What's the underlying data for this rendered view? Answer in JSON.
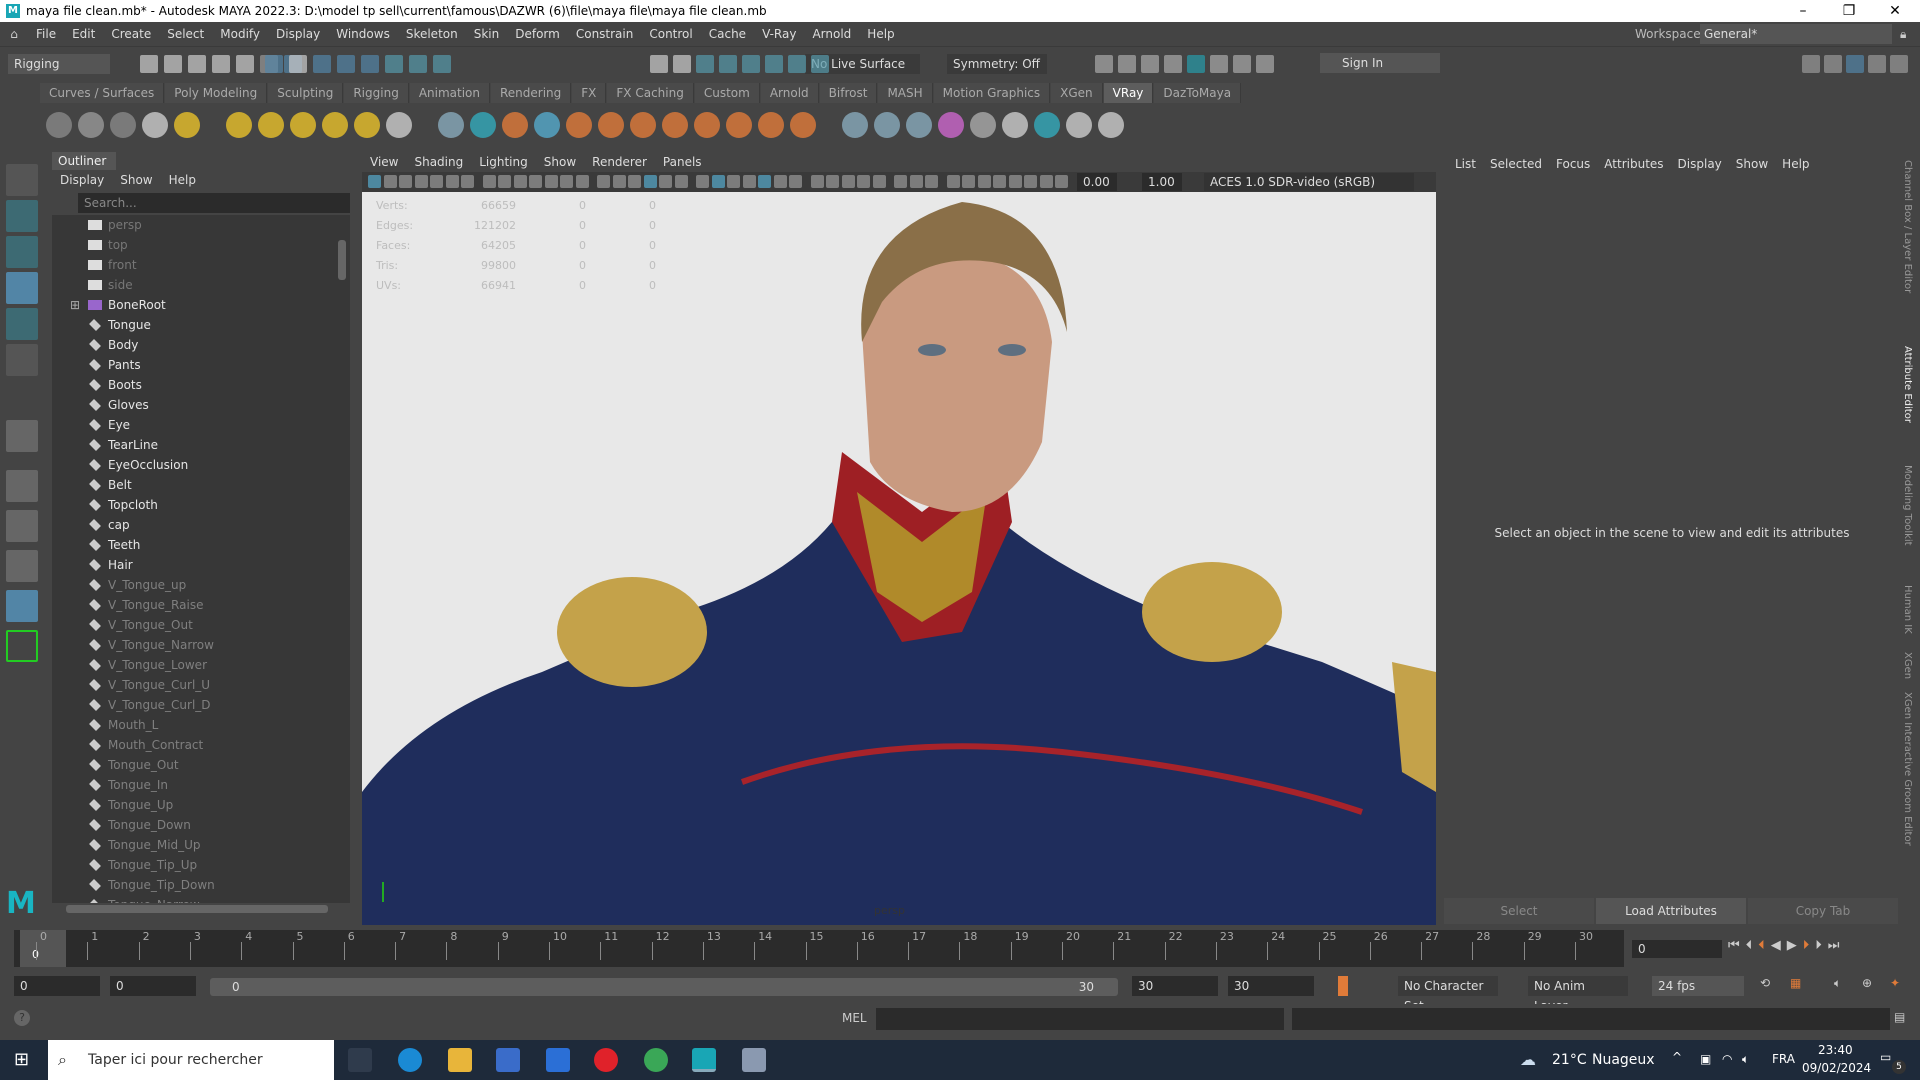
{
  "title": "maya file clean.mb* - Autodesk MAYA 2022.3: D:\\model tp sell\\current\\famous\\DAZWR (6)\\file\\maya file\\maya file clean.mb",
  "window_controls": {
    "minimize": "–",
    "maximize": "❐",
    "close": "✕"
  },
  "menus": [
    "File",
    "Edit",
    "Create",
    "Select",
    "Modify",
    "Display",
    "Windows",
    "Skeleton",
    "Skin",
    "Deform",
    "Constrain",
    "Control",
    "Cache",
    "V-Ray",
    "Arnold",
    "Help"
  ],
  "workspace": {
    "label": "Workspace:",
    "value": "General*"
  },
  "status": {
    "menuset": "Rigging",
    "live_surface": "No Live Surface",
    "symmetry": "Symmetry: Off",
    "sign_in": "Sign In"
  },
  "shelf_tabs": [
    "Curves / Surfaces",
    "Poly Modeling",
    "Sculpting",
    "Rigging",
    "Animation",
    "Rendering",
    "FX",
    "FX Caching",
    "Custom",
    "Arnold",
    "Bifrost",
    "MASH",
    "Motion Graphics",
    "XGen",
    "VRay",
    "DazToMaya"
  ],
  "shelf_active": "VRay",
  "outliner": {
    "tab": "Outliner",
    "menu": [
      "Display",
      "Show",
      "Help"
    ],
    "search_placeholder": "Search...",
    "items": [
      {
        "name": "persp",
        "kind": "cam"
      },
      {
        "name": "top",
        "kind": "cam"
      },
      {
        "name": "front",
        "kind": "cam"
      },
      {
        "name": "side",
        "kind": "cam"
      },
      {
        "name": "BoneRoot",
        "kind": "joint"
      },
      {
        "name": "Tongue",
        "kind": "bright"
      },
      {
        "name": "Body",
        "kind": "bright"
      },
      {
        "name": "Pants",
        "kind": "bright"
      },
      {
        "name": "Boots",
        "kind": "bright"
      },
      {
        "name": "Gloves",
        "kind": "bright"
      },
      {
        "name": "Eye",
        "kind": "bright"
      },
      {
        "name": "TearLine",
        "kind": "bright"
      },
      {
        "name": "EyeOcclusion",
        "kind": "bright"
      },
      {
        "name": "Belt",
        "kind": "bright"
      },
      {
        "name": "Topcloth",
        "kind": "bright"
      },
      {
        "name": "cap",
        "kind": "bright"
      },
      {
        "name": "Teeth",
        "kind": "bright"
      },
      {
        "name": "Hair",
        "kind": "bright"
      },
      {
        "name": "V_Tongue_up",
        "kind": "dim"
      },
      {
        "name": "V_Tongue_Raise",
        "kind": "dim"
      },
      {
        "name": "V_Tongue_Out",
        "kind": "dim"
      },
      {
        "name": "V_Tongue_Narrow",
        "kind": "dim"
      },
      {
        "name": "V_Tongue_Lower",
        "kind": "dim"
      },
      {
        "name": "V_Tongue_Curl_U",
        "kind": "dim"
      },
      {
        "name": "V_Tongue_Curl_D",
        "kind": "dim"
      },
      {
        "name": "Mouth_L",
        "kind": "dim"
      },
      {
        "name": "Mouth_Contract",
        "kind": "dim"
      },
      {
        "name": "Tongue_Out",
        "kind": "dim"
      },
      {
        "name": "Tongue_In",
        "kind": "dim"
      },
      {
        "name": "Tongue_Up",
        "kind": "dim"
      },
      {
        "name": "Tongue_Down",
        "kind": "dim"
      },
      {
        "name": "Tongue_Mid_Up",
        "kind": "dim"
      },
      {
        "name": "Tongue_Tip_Up",
        "kind": "dim"
      },
      {
        "name": "Tongue_Tip_Down",
        "kind": "dim"
      },
      {
        "name": "Tongue_Narrow",
        "kind": "dim"
      }
    ]
  },
  "viewport": {
    "menu": [
      "View",
      "Shading",
      "Lighting",
      "Show",
      "Renderer",
      "Panels"
    ],
    "exposure": "0.00",
    "gamma": "1.00",
    "color_space": "ACES 1.0 SDR-video (sRGB)",
    "camera_label": "persp",
    "hud": [
      [
        "Verts:",
        "66659",
        "0",
        "0"
      ],
      [
        "Edges:",
        "121202",
        "0",
        "0"
      ],
      [
        "Faces:",
        "64205",
        "0",
        "0"
      ],
      [
        "Tris:",
        "99800",
        "0",
        "0"
      ],
      [
        "UVs:",
        "66941",
        "0",
        "0"
      ]
    ]
  },
  "attribute_editor": {
    "menu": [
      "List",
      "Selected",
      "Focus",
      "Attributes",
      "Display",
      "Show",
      "Help"
    ],
    "message": "Select an object in the scene to view and edit its attributes",
    "buttons": [
      "Select",
      "Load Attributes",
      "Copy Tab"
    ]
  },
  "side_tabs": [
    "Channel Box / Layer Editor",
    "Attribute Editor",
    "Modeling Toolkit",
    "Human IK",
    "XGen",
    "XGen Interactive Groom Editor"
  ],
  "timeline": {
    "ticks": [
      "0",
      "1",
      "2",
      "3",
      "4",
      "5",
      "6",
      "7",
      "8",
      "9",
      "10",
      "11",
      "12",
      "13",
      "14",
      "15",
      "16",
      "17",
      "18",
      "19",
      "20",
      "21",
      "22",
      "23",
      "24",
      "25",
      "26",
      "27",
      "28",
      "29",
      "30"
    ],
    "current": "0",
    "current_field": "0"
  },
  "range": {
    "start": "0",
    "anim_start": "0",
    "slider_start": "0",
    "slider_end": "30",
    "anim_end": "30",
    "end": "30",
    "character_set": "No Character Set",
    "anim_layer": "No Anim Layer",
    "fps": "24 fps"
  },
  "command": {
    "label": "MEL"
  },
  "taskbar": {
    "search": "Taper ici pour rechercher",
    "weather": "21°C",
    "weather_desc": "Nuageux",
    "lang": "FRA",
    "time": "23:40",
    "date": "09/02/2024",
    "notifications": "5"
  }
}
